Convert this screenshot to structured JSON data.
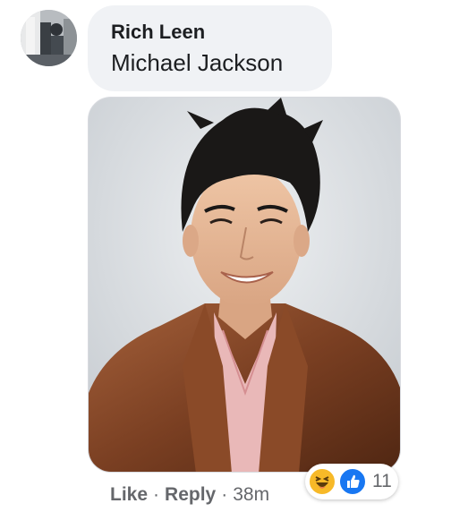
{
  "comment": {
    "author": "Rich Leen",
    "text": "Michael Jackson"
  },
  "actions": {
    "like_label": "Like",
    "reply_label": "Reply",
    "separator": "·",
    "timestamp": "38m"
  },
  "reactions": {
    "count": "11",
    "icons": [
      "haha-icon",
      "like-icon"
    ]
  },
  "colors": {
    "bubble": "#f0f2f5",
    "muted_text": "#65676b",
    "like_blue": "#1877f2",
    "haha_yellow": "#f7b928"
  }
}
